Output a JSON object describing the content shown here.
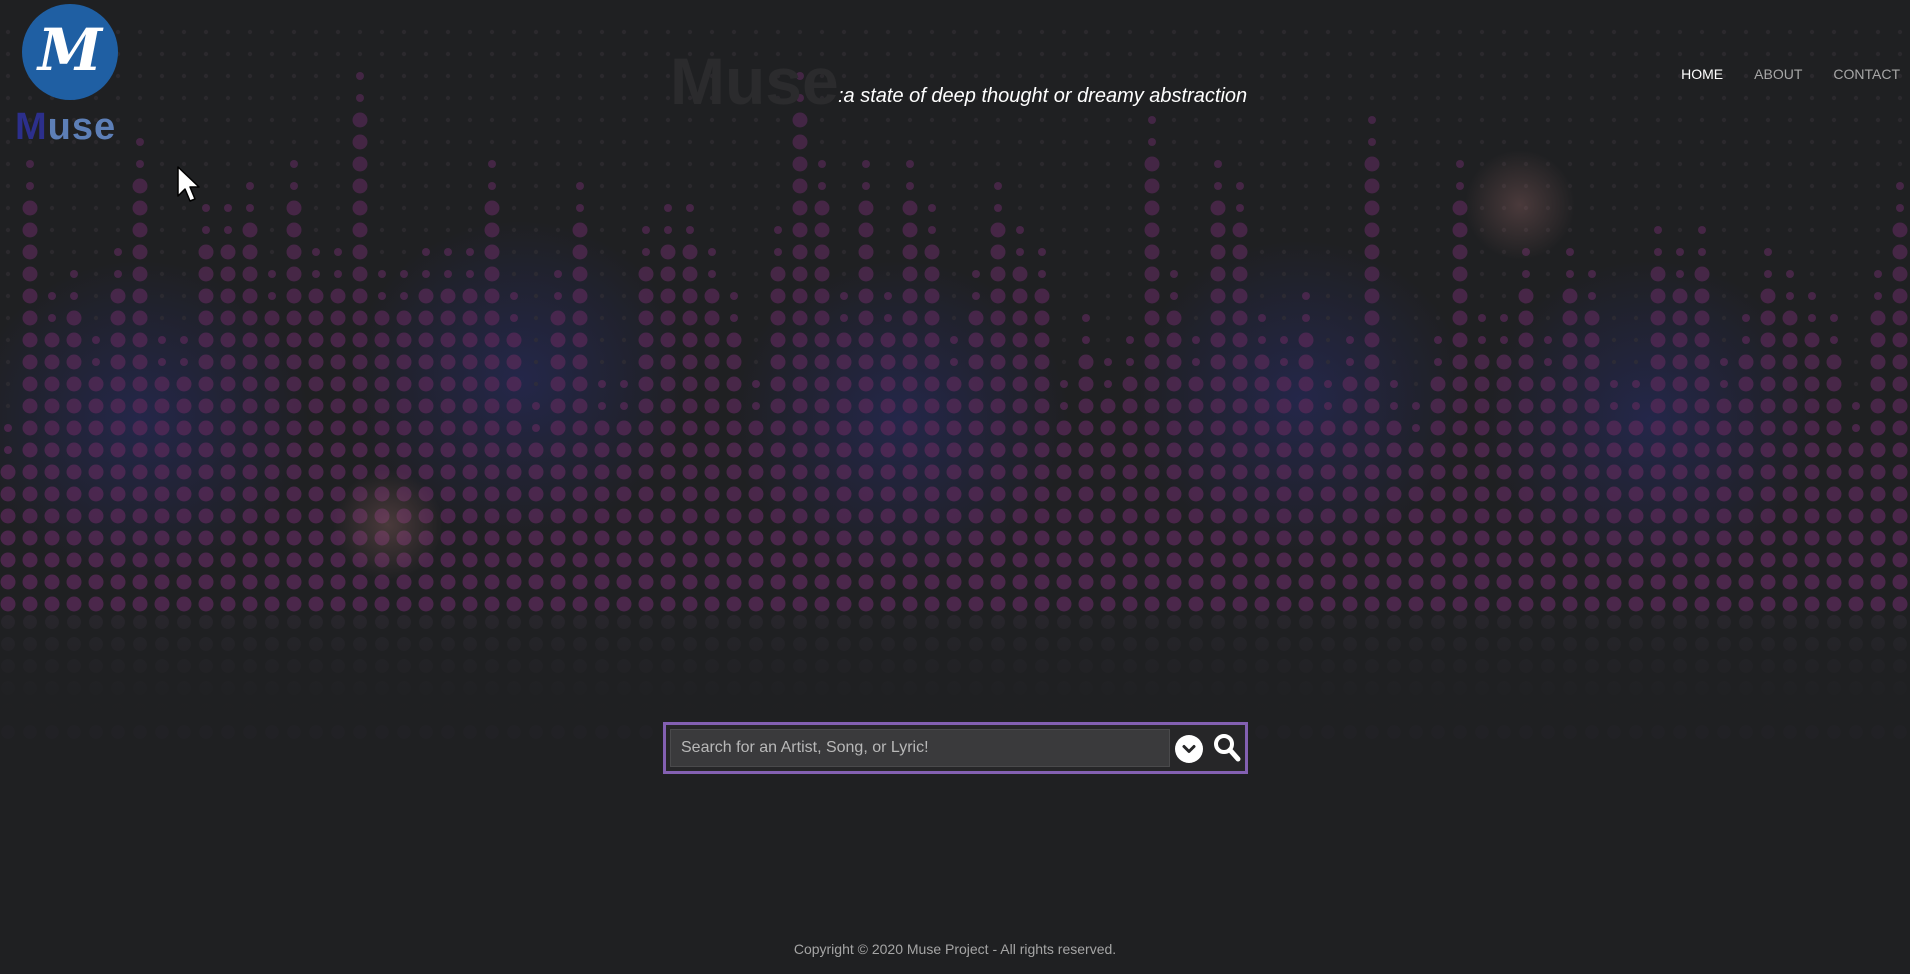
{
  "brand": {
    "logo_monogram": "M",
    "logo_word_first": "M",
    "logo_word_rest": "use",
    "ghost_title": "Muse",
    "tagline": ":a state of deep thought or dreamy abstraction"
  },
  "nav": {
    "items": [
      {
        "label": "HOME",
        "active": true
      },
      {
        "label": "ABOUT",
        "active": false
      },
      {
        "label": "CONTACT",
        "active": false
      }
    ]
  },
  "search": {
    "placeholder": "Search for an Artist, Song, or Lyric!",
    "value": "",
    "dropdown_icon": "chevron-down-circle-icon",
    "search_icon": "search-icon"
  },
  "footer": {
    "copyright": "Copyright © 2020 Muse Project - All rights reserved."
  },
  "colors": {
    "background": "#1f2022",
    "equalizer_dot": "#5b2a5a",
    "logo_blue": "#1f5fa3",
    "search_border": "#8360b2",
    "nav_active": "#ffffff",
    "nav_inactive": "#a7a7a7"
  }
}
